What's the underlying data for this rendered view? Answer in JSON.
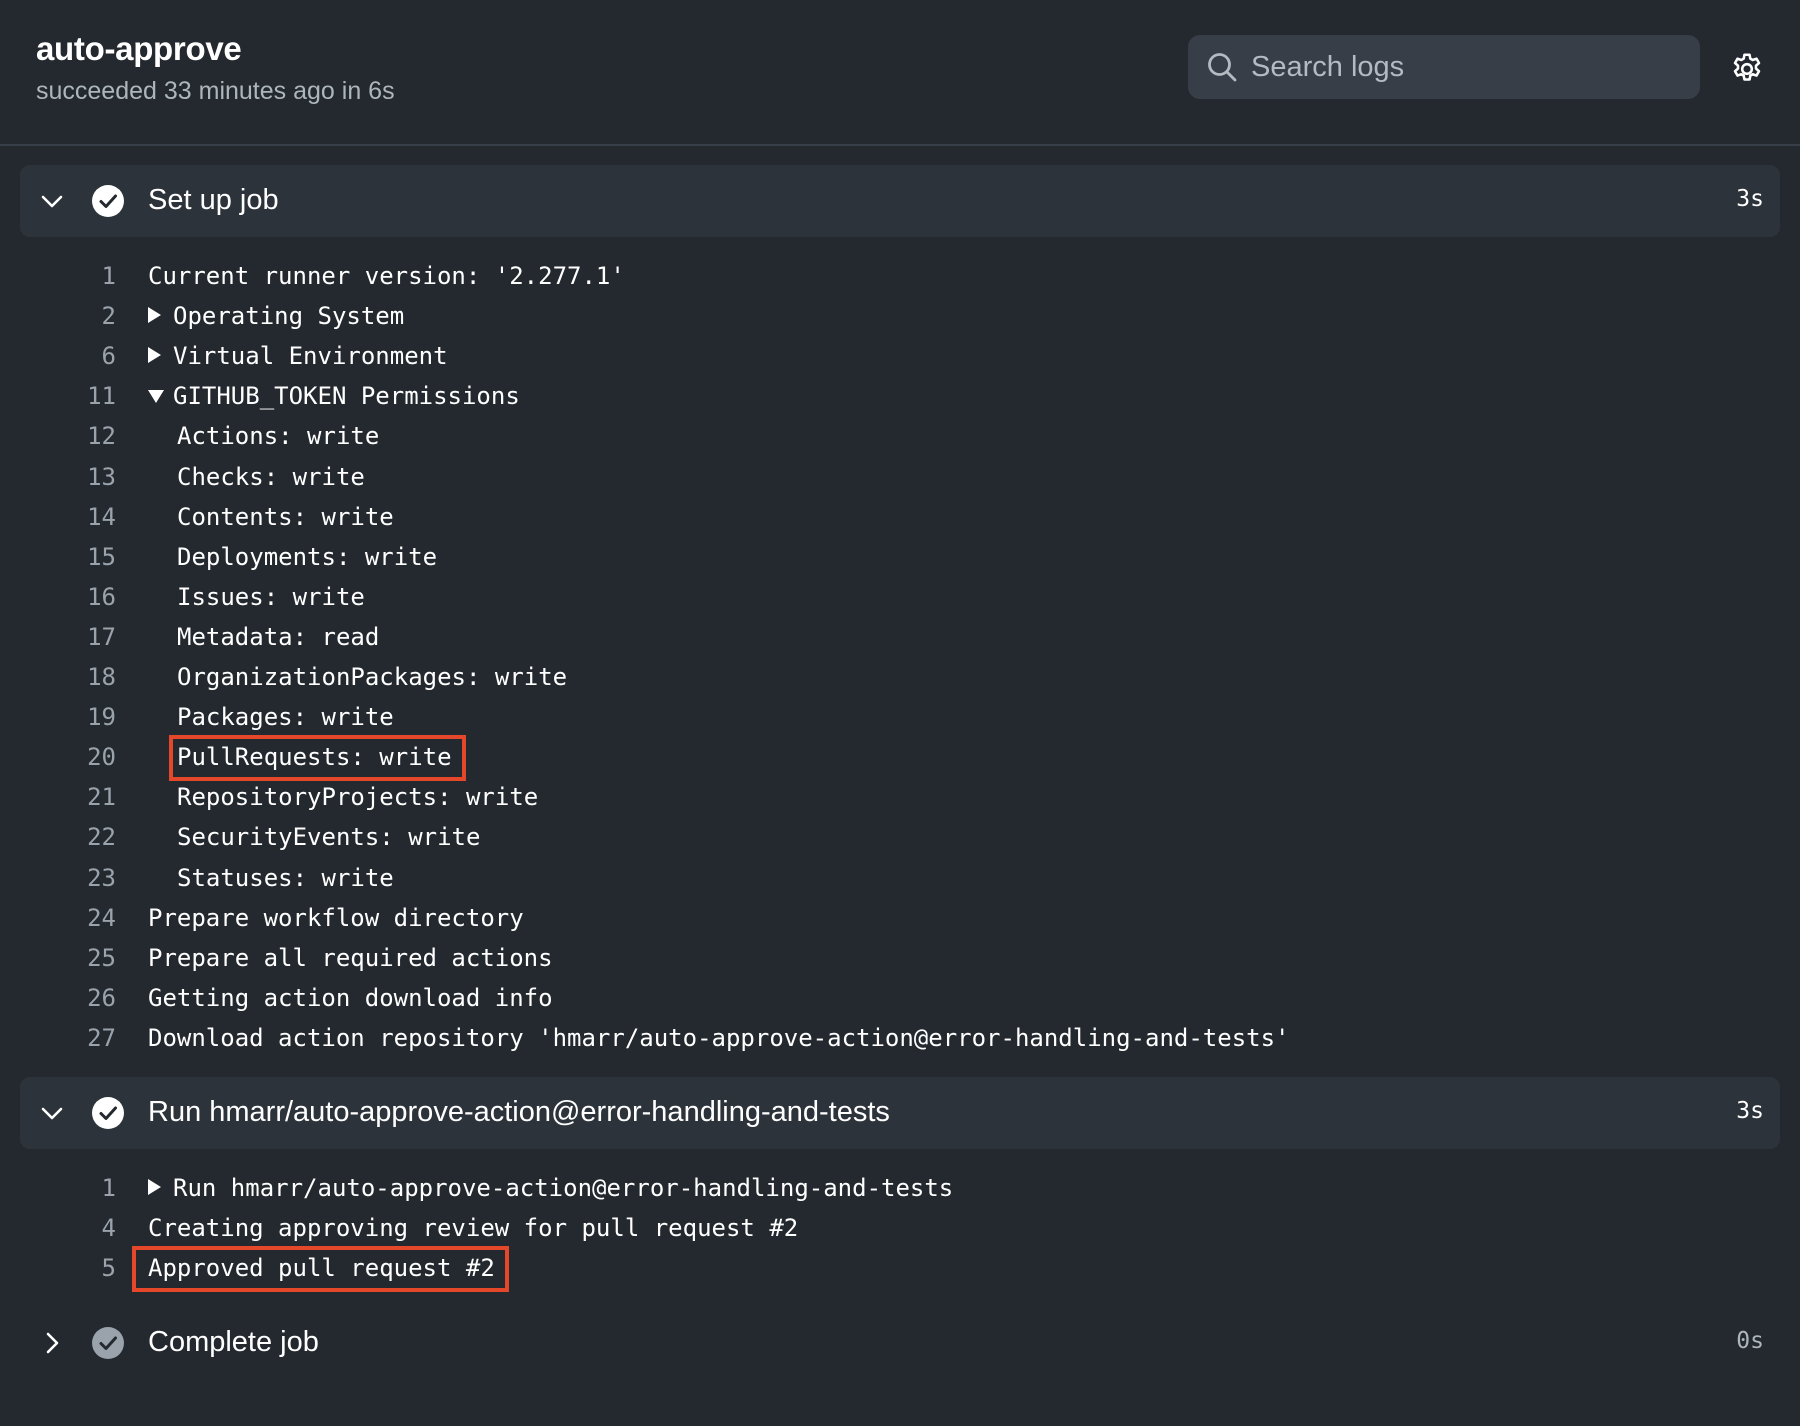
{
  "header": {
    "title": "auto-approve",
    "status": "succeeded 33 minutes ago in 6s",
    "search_placeholder": "Search logs"
  },
  "steps": [
    {
      "title": "Set up job",
      "duration": "3s",
      "expanded": true,
      "status": "success",
      "lines": [
        {
          "num": "1",
          "text": "Current runner version: '2.277.1'"
        },
        {
          "num": "2",
          "text": "Operating System",
          "toggle": "collapsed"
        },
        {
          "num": "6",
          "text": "Virtual Environment",
          "toggle": "collapsed"
        },
        {
          "num": "11",
          "text": "GITHUB_TOKEN Permissions",
          "toggle": "expanded"
        },
        {
          "num": "12",
          "text": "Actions: write",
          "indent": true
        },
        {
          "num": "13",
          "text": "Checks: write",
          "indent": true
        },
        {
          "num": "14",
          "text": "Contents: write",
          "indent": true
        },
        {
          "num": "15",
          "text": "Deployments: write",
          "indent": true
        },
        {
          "num": "16",
          "text": "Issues: write",
          "indent": true
        },
        {
          "num": "17",
          "text": "Metadata: read",
          "indent": true
        },
        {
          "num": "18",
          "text": "OrganizationPackages: write",
          "indent": true
        },
        {
          "num": "19",
          "text": "Packages: write",
          "indent": true
        },
        {
          "num": "20",
          "text": "PullRequests: write",
          "indent": true,
          "highlighted": true
        },
        {
          "num": "21",
          "text": "RepositoryProjects: write",
          "indent": true
        },
        {
          "num": "22",
          "text": "SecurityEvents: write",
          "indent": true
        },
        {
          "num": "23",
          "text": "Statuses: write",
          "indent": true
        },
        {
          "num": "24",
          "text": "Prepare workflow directory"
        },
        {
          "num": "25",
          "text": "Prepare all required actions"
        },
        {
          "num": "26",
          "text": "Getting action download info"
        },
        {
          "num": "27",
          "text": "Download action repository 'hmarr/auto-approve-action@error-handling-and-tests'"
        }
      ]
    },
    {
      "title": "Run hmarr/auto-approve-action@error-handling-and-tests",
      "duration": "3s",
      "expanded": true,
      "status": "success",
      "lines": [
        {
          "num": "1",
          "text": "Run hmarr/auto-approve-action@error-handling-and-tests",
          "toggle": "collapsed"
        },
        {
          "num": "4",
          "text": "Creating approving review for pull request #2"
        },
        {
          "num": "5",
          "text": "Approved pull request #2",
          "highlighted": true
        }
      ]
    },
    {
      "title": "Complete job",
      "duration": "0s",
      "expanded": false,
      "status": "success",
      "lines": []
    }
  ],
  "colors": {
    "background": "#24292f",
    "step_header": "#2d333b",
    "highlight": "#e4472a",
    "line_number": "#9aa3ac"
  },
  "icons": {
    "search": "search-icon",
    "settings": "gear-icon",
    "expand": "chevron-down-icon",
    "collapse": "chevron-right-icon",
    "status": "check-circle-icon"
  }
}
